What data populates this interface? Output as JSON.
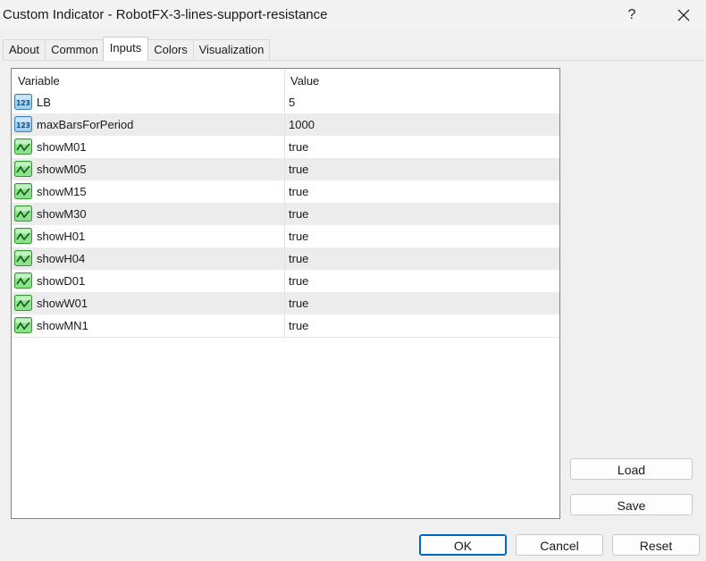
{
  "window": {
    "title": "Custom Indicator - RobotFX-3-lines-support-resistance",
    "help_label": "?"
  },
  "tabs": [
    {
      "label": "About"
    },
    {
      "label": "Common"
    },
    {
      "label": "Inputs"
    },
    {
      "label": "Colors"
    },
    {
      "label": "Visualization"
    }
  ],
  "active_tab": "Inputs",
  "grid": {
    "columns": {
      "variable": "Variable",
      "value": "Value"
    },
    "rows": [
      {
        "variable": "LB",
        "value": "5",
        "icon": "integer-icon"
      },
      {
        "variable": "maxBarsForPeriod",
        "value": "1000",
        "icon": "integer-icon"
      },
      {
        "variable": "showM01",
        "value": "true",
        "icon": "boolean-icon"
      },
      {
        "variable": "showM05",
        "value": "true",
        "icon": "boolean-icon"
      },
      {
        "variable": "showM15",
        "value": "true",
        "icon": "boolean-icon"
      },
      {
        "variable": "showM30",
        "value": "true",
        "icon": "boolean-icon"
      },
      {
        "variable": "showH01",
        "value": "true",
        "icon": "boolean-icon"
      },
      {
        "variable": "showH04",
        "value": "true",
        "icon": "boolean-icon"
      },
      {
        "variable": "showD01",
        "value": "true",
        "icon": "boolean-icon"
      },
      {
        "variable": "showW01",
        "value": "true",
        "icon": "boolean-icon"
      },
      {
        "variable": "showMN1",
        "value": "true",
        "icon": "boolean-icon"
      }
    ]
  },
  "side_buttons": {
    "load": "Load",
    "save": "Save"
  },
  "footer_buttons": {
    "ok": "OK",
    "cancel": "Cancel",
    "reset": "Reset"
  },
  "colors": {
    "accent": "#0067c0",
    "row_alt": "#ececec"
  }
}
